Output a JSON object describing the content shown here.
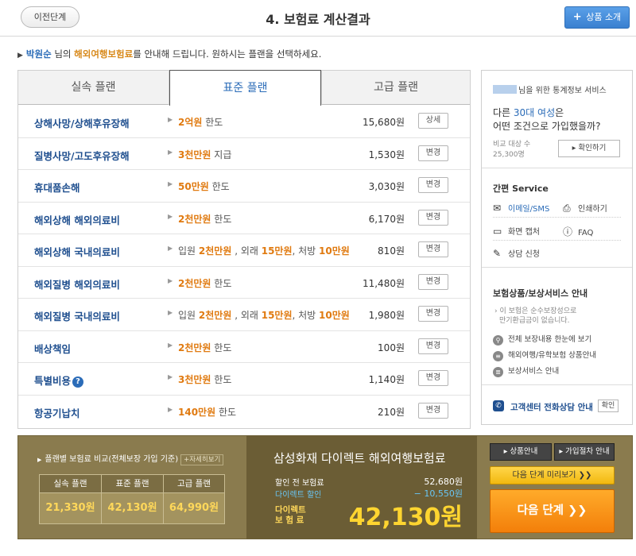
{
  "header": {
    "prev_label": "이전단계",
    "title": "4. 보험료 계산결과",
    "product_intro_icon": "+",
    "product_intro_label": "상품 소개"
  },
  "intro": {
    "user_name": "박원순",
    "text_1": " 님의 ",
    "product": "해외여행보험료",
    "text_2": "를 안내해 드립니다.  원하시는 플랜을 선택하세요."
  },
  "tabs": [
    {
      "label": "실속 플랜"
    },
    {
      "label": "표준 플랜"
    },
    {
      "label": "고급 플랜"
    }
  ],
  "selected_tab": "표준 플랜",
  "coverage": [
    {
      "label": "상해사망/상해후유장해",
      "parts": [
        {
          "amt": "2억원"
        },
        {
          "text": " 한도"
        }
      ],
      "premium": "15,680원",
      "button": "상세"
    },
    {
      "label": "질병사망/고도후유장해",
      "parts": [
        {
          "amt": "3천만원"
        },
        {
          "text": " 지급"
        }
      ],
      "premium": "1,530원",
      "button": "변경"
    },
    {
      "label": "휴대품손해",
      "parts": [
        {
          "amt": "50만원"
        },
        {
          "text": " 한도"
        }
      ],
      "premium": "3,030원",
      "button": "변경"
    },
    {
      "label": "해외상해 해외의료비",
      "parts": [
        {
          "amt": "2천만원"
        },
        {
          "text": " 한도"
        }
      ],
      "premium": "6,170원",
      "button": "변경"
    },
    {
      "label": "해외상해 국내의료비",
      "parts": [
        {
          "text": "입원 "
        },
        {
          "amt": "2천만원"
        },
        {
          "text": " , 외래 "
        },
        {
          "amt": "15만원"
        },
        {
          "text": ", 처방 "
        },
        {
          "amt": "10만원"
        }
      ],
      "premium": "810원",
      "button": "변경"
    },
    {
      "label": "해외질병 해외의료비",
      "parts": [
        {
          "amt": "2천만원"
        },
        {
          "text": " 한도"
        }
      ],
      "premium": "11,480원",
      "button": "변경"
    },
    {
      "label": "해외질병 국내의료비",
      "parts": [
        {
          "text": "입원 "
        },
        {
          "amt": "2천만원"
        },
        {
          "text": " , 외래 "
        },
        {
          "amt": "15만원"
        },
        {
          "text": ", 처방 "
        },
        {
          "amt": "10만원"
        }
      ],
      "premium": "1,980원",
      "button": "변경"
    },
    {
      "label": "배상책임",
      "parts": [
        {
          "amt": "2천만원"
        },
        {
          "text": " 한도"
        }
      ],
      "premium": "100원",
      "button": "변경"
    },
    {
      "label": "특별비용",
      "help": "?",
      "parts": [
        {
          "amt": "3천만원"
        },
        {
          "text": " 한도"
        }
      ],
      "premium": "1,140원",
      "button": "변경"
    },
    {
      "label": "항공기납치",
      "parts": [
        {
          "amt": "140만원"
        },
        {
          "text": " 한도"
        }
      ],
      "premium": "210원",
      "button": "변경"
    }
  ],
  "sidebar": {
    "stats": {
      "title": "님을 위한 통계정보 서비스",
      "q_prefix": "다른 ",
      "q_highlight": "30대 여성",
      "q_suffix": "은",
      "q_line2": "어떤 조건으로 가입했을까?",
      "meta_1": "비교 대상 수",
      "meta_2": "25,300명",
      "button": "▸ 확인하기"
    },
    "service": {
      "title": "간편 Service",
      "email": "이메일/SMS",
      "print": "인쇄하기",
      "capture": "화면 캡처",
      "faq": "FAQ",
      "consult": "상담 신청"
    },
    "guide": {
      "title": "보험상품/보상서비스 안내",
      "note_1": "› 이 보험은 순수보장성으로",
      "note_2": "만기환급금이 없습니다.",
      "items": [
        "전체 보장내용 한눈에 보기",
        "해외여행/유학보험 상품안내",
        "보상서비스 안내"
      ]
    },
    "call": {
      "label": "고객센터 전화상담 안내",
      "button": "확인"
    }
  },
  "bottom": {
    "compare_title": "플랜별 보험료 비교(전체보장 가입 기준)",
    "compare_more": "+자세히보기",
    "compare_heads": [
      "실속 플랜",
      "표준 플랜",
      "고급 플랜"
    ],
    "compare_vals": [
      "21,330원",
      "42,130원",
      "64,990원"
    ],
    "summary": {
      "title": "삼성화재 다이렉트 해외여행보험료",
      "before_label": "할인 전 보험료",
      "before_value": "52,680원",
      "discount_label": "다이렉트 할인",
      "discount_value": "− 10,550원",
      "direct_label_1": "다이렉트",
      "direct_label_2": "보 험 료",
      "total": "42,130원"
    },
    "buttons": {
      "product_guide": "▸ 상품안내",
      "join_guide": "▸ 가입절차 안내",
      "preview": "다음 단계 미리보기  ❯❯",
      "next": "다음 단계  ❯❯"
    }
  },
  "colors": {
    "accent_blue": "#2b6cb8",
    "amount_orange": "#e07a10",
    "bottom_bg": "#8a7b4e",
    "total_yellow": "#ffd530"
  }
}
